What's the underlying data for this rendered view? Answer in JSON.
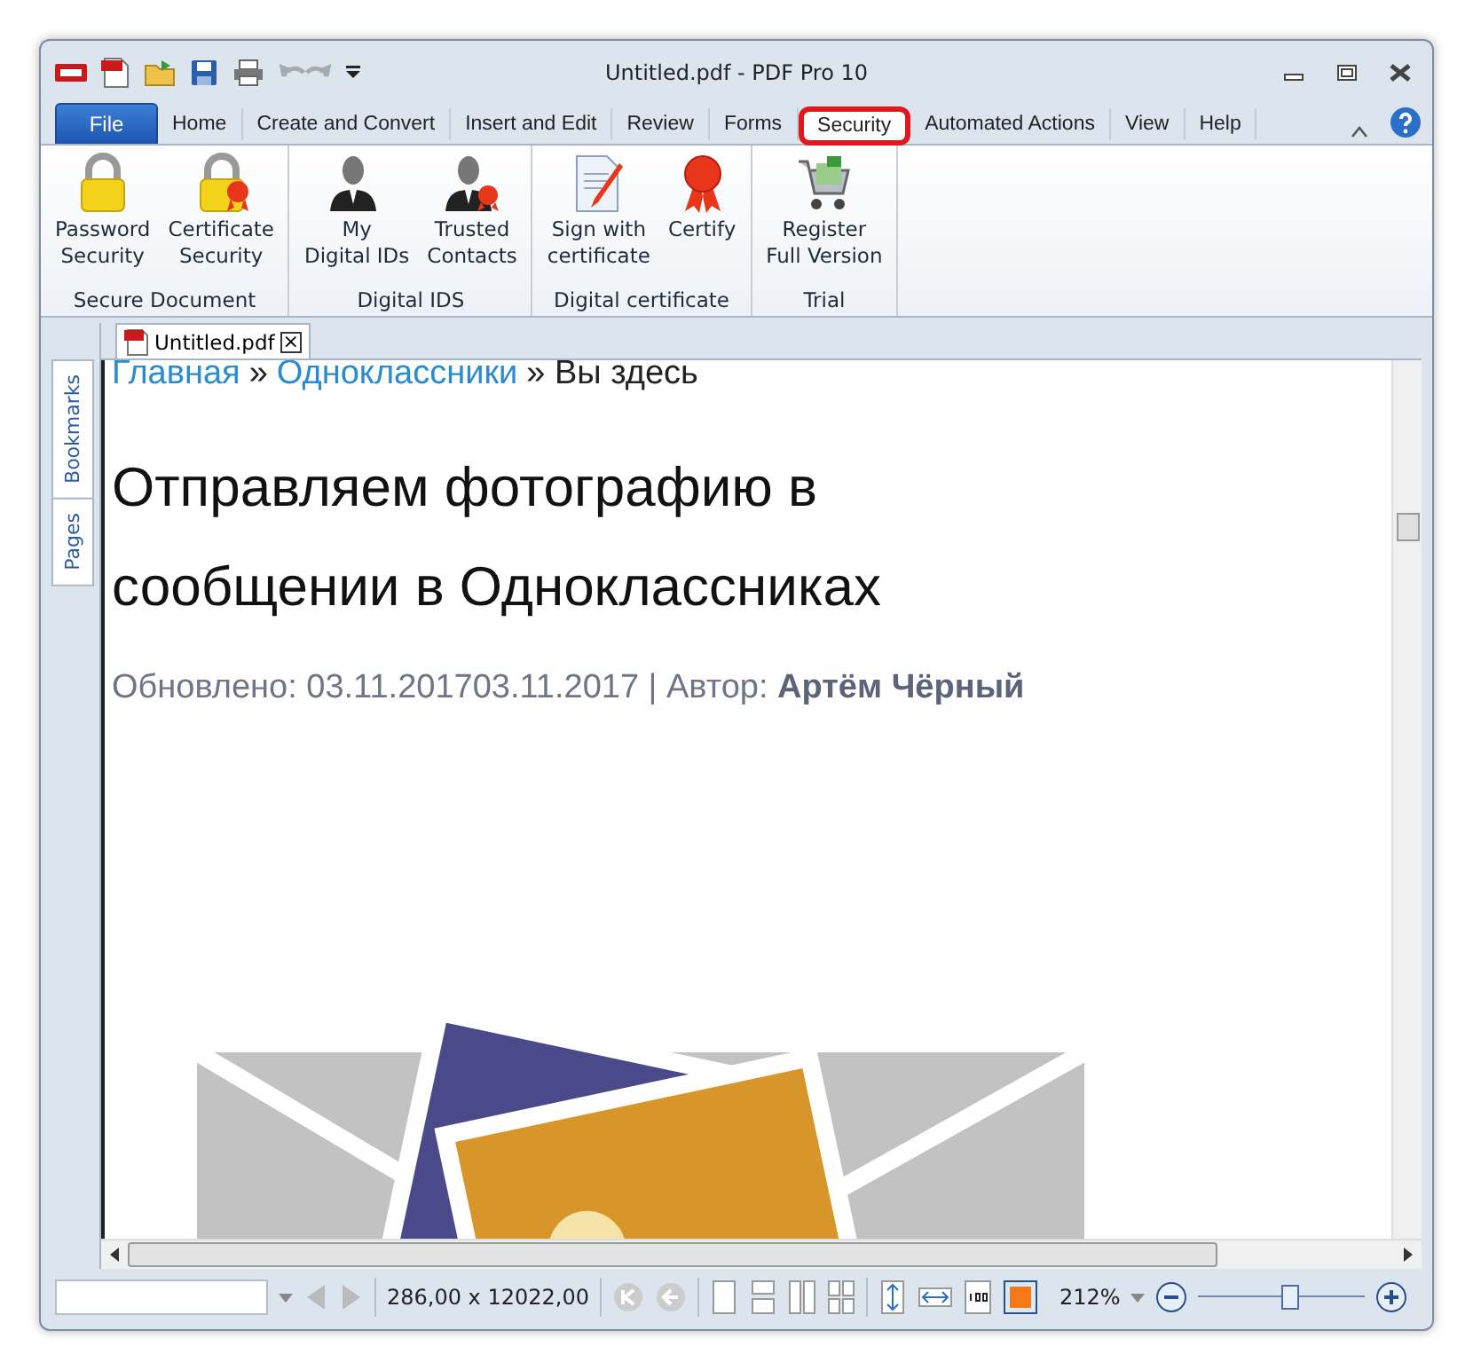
{
  "window": {
    "title": "Untitled.pdf - PDF Pro 10"
  },
  "tabs": [
    {
      "label": "File",
      "kind": "file",
      "selected": false,
      "highlighted": false
    },
    {
      "label": "Home",
      "kind": "tab",
      "selected": false,
      "highlighted": false
    },
    {
      "label": "Create and Convert",
      "kind": "tab",
      "selected": false,
      "highlighted": false
    },
    {
      "label": "Insert and Edit",
      "kind": "tab",
      "selected": false,
      "highlighted": false
    },
    {
      "label": "Review",
      "kind": "tab",
      "selected": false,
      "highlighted": false
    },
    {
      "label": "Forms",
      "kind": "tab",
      "selected": false,
      "highlighted": false
    },
    {
      "label": "Security",
      "kind": "tab",
      "selected": true,
      "highlighted": true
    },
    {
      "label": "Automated Actions",
      "kind": "tab",
      "selected": false,
      "highlighted": false
    },
    {
      "label": "View",
      "kind": "tab",
      "selected": false,
      "highlighted": false
    },
    {
      "label": "Help",
      "kind": "tab",
      "selected": false,
      "highlighted": false
    }
  ],
  "ribbon": [
    {
      "label": "Secure Document",
      "buttons": [
        {
          "lines": [
            "Password",
            "Security"
          ],
          "kind": "lock"
        },
        {
          "lines": [
            "Certificate",
            "Security"
          ],
          "kind": "lock-seal"
        }
      ]
    },
    {
      "label": "Digital IDS",
      "buttons": [
        {
          "lines": [
            "My",
            "Digital IDs"
          ],
          "kind": "person"
        },
        {
          "lines": [
            "Trusted",
            "Contacts"
          ],
          "kind": "person-seal"
        }
      ]
    },
    {
      "label": "Digital certificate",
      "buttons": [
        {
          "lines": [
            "Sign with",
            "certificate"
          ],
          "kind": "sign"
        },
        {
          "lines": [
            "Certify"
          ],
          "kind": "seal"
        }
      ]
    },
    {
      "label": "Trial",
      "buttons": [
        {
          "lines": [
            "Register",
            "Full Version"
          ],
          "kind": "cart"
        }
      ]
    }
  ],
  "document_tab": {
    "label": "Untitled.pdf",
    "close": "×"
  },
  "side_tabs": [
    {
      "label": "Bookmarks",
      "selected": false
    },
    {
      "label": "Pages",
      "selected": false
    }
  ],
  "document": {
    "breadcrumb": [
      {
        "text": "Главная",
        "kind": "link"
      },
      {
        "text": "»",
        "kind": "sep"
      },
      {
        "text": "Одноклассники",
        "kind": "link"
      },
      {
        "text": "» Вы здесь",
        "kind": "plain"
      }
    ],
    "heading": "Отправляем фотографию в сообщении в Одноклассниках",
    "meta": "Обновлено: 03.11.201703.11.2017 | Автор: **Артём Чёрный**"
  },
  "status_bar": {
    "dimensions": "286,00 x 12022,00",
    "zoom": "212%",
    "zoom_slider": {
      "level": 0.55
    }
  }
}
